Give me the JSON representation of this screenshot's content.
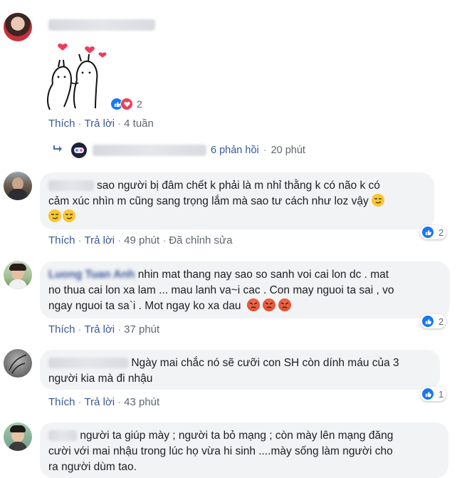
{
  "comments": [
    {
      "text": "",
      "reaction_count": "2",
      "actions": {
        "like": "Thích",
        "reply": "Trả lời",
        "time": "4 tuần"
      },
      "replies_summary": {
        "count_text": "6 phản hồi",
        "time": "20 phút"
      }
    },
    {
      "text_line1": "sao người bị đâm chết k phải là m nhỉ thằng k có não k có",
      "text_line2": "cảm xúc nhìn m cũng sang trọng lắm mà sao tư cách như loz vậy",
      "name_partial": "· ·· ·· · ·· ·· ·uc",
      "reaction_count": "2",
      "actions": {
        "like": "Thích",
        "reply": "Trả lời",
        "time": "49 phút",
        "edited": "Đã chỉnh sửa"
      }
    },
    {
      "name_partial": "Luong Tuan Anh",
      "text_line1": "nhin mat thang nay sao so sanh voi cai lon dc . mat",
      "text_line2": "no thua cai lon xa lam ... mau lanh va~i cac . Con may nguoi ta sai , vo",
      "text_line3": "ngay nguoi ta sa`i . Mot ngay ko xa dau",
      "reaction_count": "2",
      "actions": {
        "like": "Thích",
        "reply": "Trả lời",
        "time": "37 phút"
      }
    },
    {
      "text_line1": "Ngày mai chắc nó sẽ cưỡi con SH còn dính máu của 3",
      "text_line2": "người kia mà đi nhậu",
      "reaction_count": "1",
      "actions": {
        "like": "Thích",
        "reply": "Trả lời",
        "time": "43 phút"
      }
    },
    {
      "text_line1": "người ta giúp mày ; người ta bỏ mạng ; còn mày lên mạng đăng",
      "text_line2": "cười với mai nhậu trong lúc họ vừa hi sinh ....mày sống làm người cho",
      "text_line3": "ra người dùm tao."
    }
  ],
  "colors": {
    "link": "#385898",
    "meta": "#606770",
    "bubble": "#f2f3f5",
    "like": "#1877f2",
    "love": "#f33e58"
  }
}
